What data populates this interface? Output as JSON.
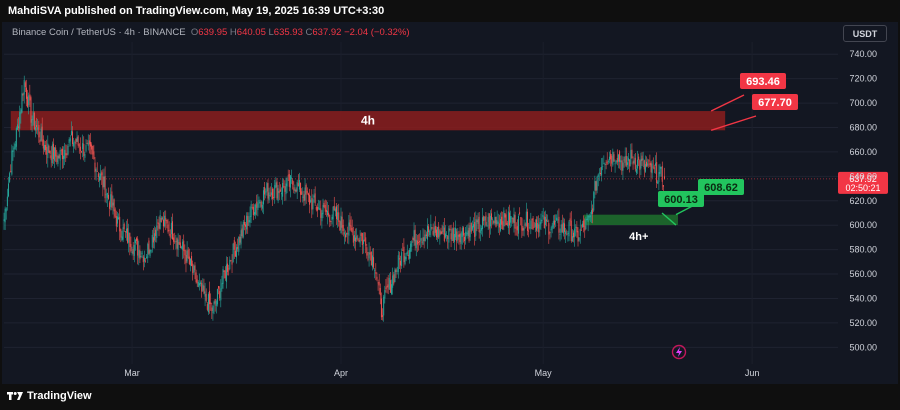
{
  "header": {
    "published": "MahdiSVA published on TradingView.com, May 19, 2025 16:39 UTC+3:30"
  },
  "symbol_bar": {
    "name": "Binance Coin / TetherUS · 4h · BINANCE",
    "o_label": "O",
    "o": "639.95",
    "h_label": "H",
    "h": "640.05",
    "l_label": "L",
    "l": "635.93",
    "c_label": "C",
    "c": "637.92",
    "change": "−2.04 (−0.32%)"
  },
  "currency_button": "USDT",
  "footer": {
    "brand": "TradingView"
  },
  "colors": {
    "background": "#131722",
    "up": "#26a69a",
    "down": "#ef5350",
    "resistance_zone": "#8b1d1d",
    "support_zone": "#1e6b2c",
    "label_red": "#f23645",
    "label_green": "#22c55e"
  },
  "chart_data": {
    "type": "candlestick",
    "timeframe": "4h",
    "y_ticks": [
      500,
      520,
      540,
      560,
      580,
      600,
      620,
      640,
      660,
      680,
      700,
      720,
      740
    ],
    "y_tick_labels": [
      "500.00",
      "520.00",
      "540.00",
      "560.00",
      "580.00",
      "600.00",
      "620.00",
      "640.00",
      "660.00",
      "680.00",
      "700.00",
      "720.00",
      "740.00"
    ],
    "ylim": [
      488,
      750
    ],
    "x_tick_labels": [
      "Mar",
      "Apr",
      "May",
      "Jun"
    ],
    "x_range": [
      "2025-02-10",
      "2025-06-13"
    ],
    "last_price": 637.92,
    "last_price_label": "637.92",
    "countdown": "02:50:21",
    "close_path": [
      [
        "2025-02-10",
        605
      ],
      [
        "2025-02-11",
        650
      ],
      [
        "2025-02-12",
        680
      ],
      [
        "2025-02-13",
        718
      ],
      [
        "2025-02-14",
        690
      ],
      [
        "2025-02-16",
        665
      ],
      [
        "2025-02-18",
        655
      ],
      [
        "2025-02-20",
        670
      ],
      [
        "2025-02-23",
        658
      ],
      [
        "2025-02-25",
        630
      ],
      [
        "2025-02-27",
        600
      ],
      [
        "2025-03-01",
        585
      ],
      [
        "2025-03-03",
        575
      ],
      [
        "2025-03-05",
        605
      ],
      [
        "2025-03-07",
        595
      ],
      [
        "2025-03-09",
        575
      ],
      [
        "2025-03-11",
        548
      ],
      [
        "2025-03-13",
        530
      ],
      [
        "2025-03-15",
        565
      ],
      [
        "2025-03-17",
        590
      ],
      [
        "2025-03-19",
        615
      ],
      [
        "2025-03-21",
        628
      ],
      [
        "2025-03-23",
        630
      ],
      [
        "2025-03-25",
        635
      ],
      [
        "2025-03-27",
        622
      ],
      [
        "2025-03-29",
        612
      ],
      [
        "2025-03-31",
        608
      ],
      [
        "2025-04-02",
        595
      ],
      [
        "2025-04-04",
        590
      ],
      [
        "2025-04-06",
        570
      ],
      [
        "2025-04-07",
        530
      ],
      [
        "2025-04-08",
        548
      ],
      [
        "2025-04-10",
        575
      ],
      [
        "2025-04-12",
        590
      ],
      [
        "2025-04-14",
        595
      ],
      [
        "2025-04-17",
        593
      ],
      [
        "2025-04-20",
        595
      ],
      [
        "2025-04-22",
        600
      ],
      [
        "2025-04-24",
        605
      ],
      [
        "2025-04-26",
        604
      ],
      [
        "2025-04-29",
        603
      ],
      [
        "2025-05-02",
        600
      ],
      [
        "2025-05-05",
        596
      ],
      [
        "2025-05-06",
        590
      ],
      [
        "2025-05-08",
        605
      ],
      [
        "2025-05-09",
        640
      ],
      [
        "2025-05-10",
        655
      ],
      [
        "2025-05-12",
        658
      ],
      [
        "2025-05-13",
        648
      ],
      [
        "2025-05-14",
        655
      ],
      [
        "2025-05-16",
        648
      ],
      [
        "2025-05-18",
        642
      ],
      [
        "2025-05-19",
        637.92
      ]
    ],
    "zones": [
      {
        "label": "4h",
        "low": 677.7,
        "high": 693.46,
        "from": "2025-02-11",
        "to": "2025-05-28",
        "kind": "resistance"
      },
      {
        "label": "4h+",
        "low": 600.13,
        "high": 608.62,
        "from": "2025-05-07",
        "to": "2025-05-21",
        "kind": "support"
      }
    ],
    "price_labels": [
      {
        "text": "693.46",
        "value": 693.46,
        "kind": "resistance"
      },
      {
        "text": "677.70",
        "value": 677.7,
        "kind": "resistance"
      },
      {
        "text": "608.62",
        "value": 608.62,
        "kind": "support"
      },
      {
        "text": "600.13",
        "value": 600.13,
        "kind": "support"
      }
    ]
  }
}
